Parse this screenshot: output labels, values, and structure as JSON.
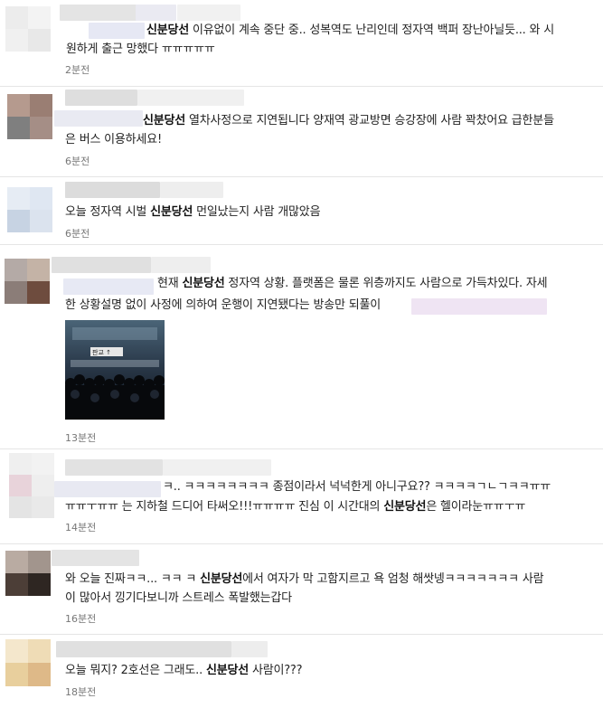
{
  "posts": [
    {
      "line1_kw": "신분당선",
      "line1_rest": " 이유없이 계속 중단 중.. 성복역도 난리인데 정자역 백퍼 장난아닐듯... 와 시",
      "line2": "원하게 출근 망했다 ㅠㅠㅠㅠㅠ",
      "time": "2분전"
    },
    {
      "line1_kw": "신분당선",
      "line1_rest": " 열차사정으로 지연됩니다 양재역 광교방면 승강장에 사람 꽉찼어요 급한분들",
      "line2": "은 버스 이용하세요!",
      "time": "6분전"
    },
    {
      "line1_pre": "오늘 정자역 시벌 ",
      "line1_kw": "신분당선",
      "line1_rest": " 먼일났는지 사람 개많았음",
      "time": "6분전"
    },
    {
      "line1_pre": "현재 ",
      "line1_kw": "신분당선",
      "line1_rest": " 정자역 상황. 플랫폼은 물론 위층까지도 사람으로 가득차있다. 자세",
      "line2": "한 상황설명 없이 사정에 의하여 운행이 지연됐다는 방송만 되풀이",
      "photo_sign": "판교 ↑",
      "time": "13분전"
    },
    {
      "line1": "ㅋ.. ㅋㅋㅋㅋㅋㅋㅋㅋ 종점이라서 넉넉한게 아니구요?? ㅋㅋㅋㅋㄱㄴㄱㅋㅋㅠㅠ",
      "line2_pre": "ㅠㅠㅜㅠㅠ 는 지하철 드디어 타써오!!!ㅠㅠㅠㅠ 진심 이 시간대의 ",
      "line2_kw": "신분당선",
      "line2_rest": "은 헬이라눈ㅠㅠㅜㅠ",
      "time": "14분전"
    },
    {
      "line1_pre": "와 오늘 진짜ㅋㅋ... ㅋㅋ ㅋ ",
      "line1_kw": "신분당선",
      "line1_rest": "에서 여자가 막 고함지르고 욕 엄청 해쌋넹ㅋㅋㅋㅋㅋㅋㅋ 사람",
      "line2": "이 많아서 낑기다보니까 스트레스 폭발했는갑다",
      "time": "16분전"
    },
    {
      "line1_pre": "오늘 뭐지? 2호선은 그래도.. ",
      "line1_kw": "신분당선",
      "line1_rest": " 사람이???",
      "time": "18분전"
    }
  ]
}
